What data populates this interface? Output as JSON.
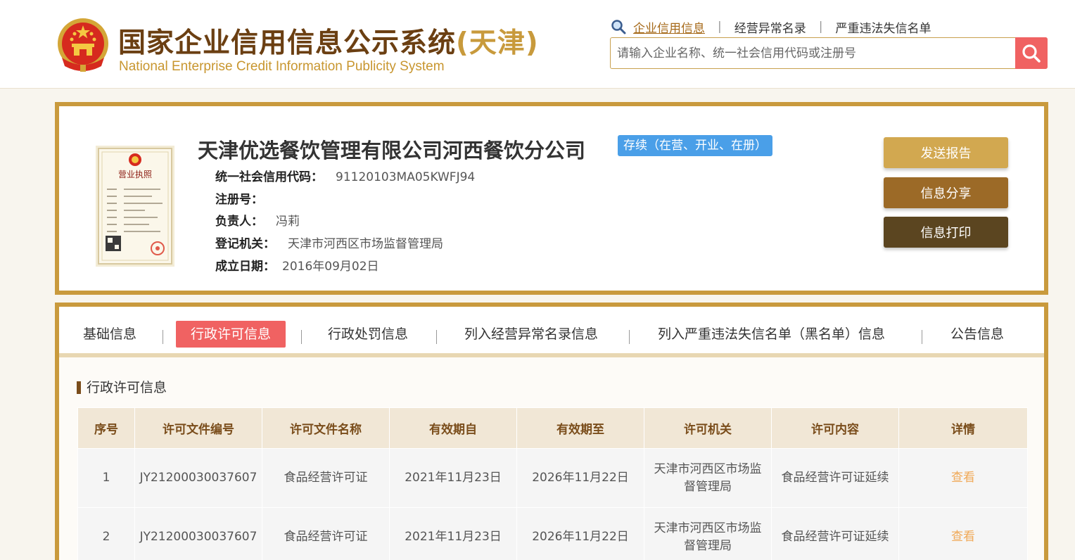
{
  "header": {
    "title_main": "国家企业信用信息公示系统",
    "title_region": "(天津)",
    "subtitle": "National Enterprise Credit Information Publicity System",
    "links": [
      {
        "label": "企业信用信息",
        "active": true
      },
      {
        "label": "经营异常名录",
        "active": false
      },
      {
        "label": "严重违法失信名单",
        "active": false
      }
    ],
    "search": {
      "placeholder": "请输入企业名称、统一社会信用代码或注册号"
    }
  },
  "company": {
    "name": "天津优选餐饮管理有限公司河西餐饮分公司",
    "status": "存续（在营、开业、在册）",
    "license_image_title": "营业执照",
    "fields": [
      {
        "label": "统一社会信用代码：",
        "value": "91120103MA05KWFJ94"
      },
      {
        "label": "注册号：",
        "value": ""
      },
      {
        "label": "负责人：",
        "value": "冯莉"
      },
      {
        "label": "登记机关：",
        "value": "天津市河西区市场监督管理局"
      },
      {
        "label": "成立日期：",
        "value": "2016年09月02日"
      }
    ],
    "actions": {
      "send_report": "发送报告",
      "share": "信息分享",
      "print": "信息打印"
    }
  },
  "tabs": [
    {
      "label": "基础信息",
      "active": false
    },
    {
      "label": "行政许可信息",
      "active": true
    },
    {
      "label": "行政处罚信息",
      "active": false
    },
    {
      "label": "列入经营异常名录信息",
      "active": false
    },
    {
      "label": "列入严重违法失信名单（黑名单）信息",
      "active": false
    },
    {
      "label": "公告信息",
      "active": false
    }
  ],
  "permit_section": {
    "title": "行政许可信息",
    "columns": [
      "序号",
      "许可文件编号",
      "许可文件名称",
      "有效期自",
      "有效期至",
      "许可机关",
      "许可内容",
      "详情"
    ],
    "rows": [
      [
        "1",
        "JY21200030037607",
        "食品经营许可证",
        "2021年11月23日",
        "2026年11月22日",
        "天津市河西区市场监督管理局",
        "食品经营许可证延续",
        "查看"
      ],
      [
        "2",
        "JY21200030037607",
        "食品经营许可证",
        "2021年11月23日",
        "2026年11月22日",
        "天津市河西区市场监督管理局",
        "食品经营许可证延续",
        "查看"
      ]
    ]
  },
  "colors": {
    "brand_brown": "#6b3f12",
    "gold": "#c99a3d",
    "accent_red": "#f06262",
    "status_blue": "#4a9fe8",
    "link_orange": "#f0a958"
  }
}
